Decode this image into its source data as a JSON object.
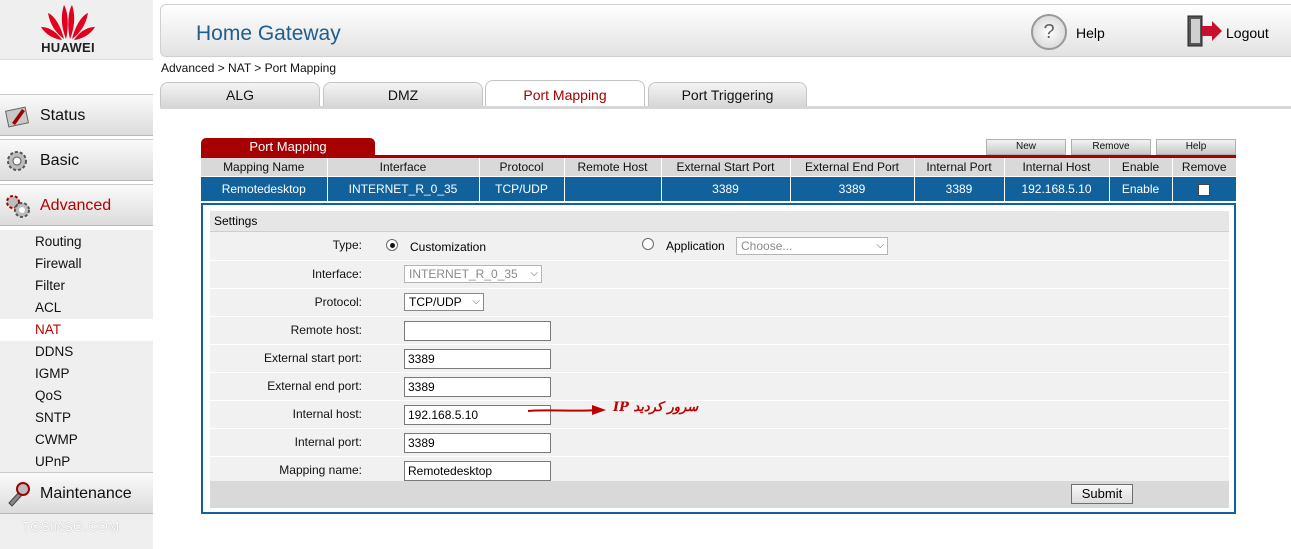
{
  "brand": {
    "name": "HUAWEI"
  },
  "header": {
    "title": "Home Gateway",
    "help_label": "Help",
    "logout_label": "Logout"
  },
  "sidebar": {
    "main_items": [
      {
        "label": "Status",
        "icon": "status-icon"
      },
      {
        "label": "Basic",
        "icon": "gear-icon"
      },
      {
        "label": "Advanced",
        "icon": "advanced-icon"
      },
      {
        "label": "Maintenance",
        "icon": "maintenance-icon"
      }
    ],
    "sub_items": [
      "Routing",
      "Firewall",
      "Filter",
      "ACL",
      "NAT",
      "DDNS",
      "IGMP",
      "QoS",
      "SNTP",
      "CWMP",
      "UPnP"
    ],
    "active_sub": "NAT"
  },
  "watermark": "TOSINSO.COM",
  "breadcrumb": "Advanced > NAT > Port Mapping",
  "tabs": [
    {
      "label": "ALG"
    },
    {
      "label": "DMZ"
    },
    {
      "label": "Port Mapping",
      "active": true
    },
    {
      "label": "Port Triggering"
    }
  ],
  "port_mapping": {
    "title": "Port Mapping",
    "buttons": {
      "new": "New",
      "remove": "Remove",
      "help": "Help"
    },
    "columns": [
      "Mapping Name",
      "Interface",
      "Protocol",
      "Remote Host",
      "External Start Port",
      "External End Port",
      "Internal Port",
      "Internal Host",
      "Enable",
      "Remove"
    ],
    "rows": [
      [
        "Remotedesktop",
        "INTERNET_R_0_35",
        "TCP/UDP",
        "",
        "3389",
        "3389",
        "3389",
        "192.168.5.10",
        "Enable",
        ""
      ]
    ]
  },
  "settings": {
    "heading": "Settings",
    "type_label": "Type:",
    "type_customization": "Customization",
    "type_application": "Application",
    "application_placeholder": "Choose...",
    "interface_label": "Interface:",
    "interface_value": "INTERNET_R_0_35",
    "protocol_label": "Protocol:",
    "protocol_value": "TCP/UDP",
    "remote_host_label": "Remote host:",
    "remote_host_value": "",
    "ext_start_label": "External start port:",
    "ext_start_value": "3389",
    "ext_end_label": "External end port:",
    "ext_end_value": "3389",
    "internal_host_label": "Internal host:",
    "internal_host_value": "192.168.5.10",
    "internal_port_label": "Internal port:",
    "internal_port_value": "3389",
    "mapping_name_label": "Mapping name:",
    "mapping_name_value": "Remotedesktop",
    "submit_label": "Submit"
  },
  "annotation": {
    "text": "IP سرور کردید"
  },
  "colors": {
    "accent_red": "#a60000",
    "selected_blue": "#11629c",
    "title_blue": "#1f5d8c"
  }
}
